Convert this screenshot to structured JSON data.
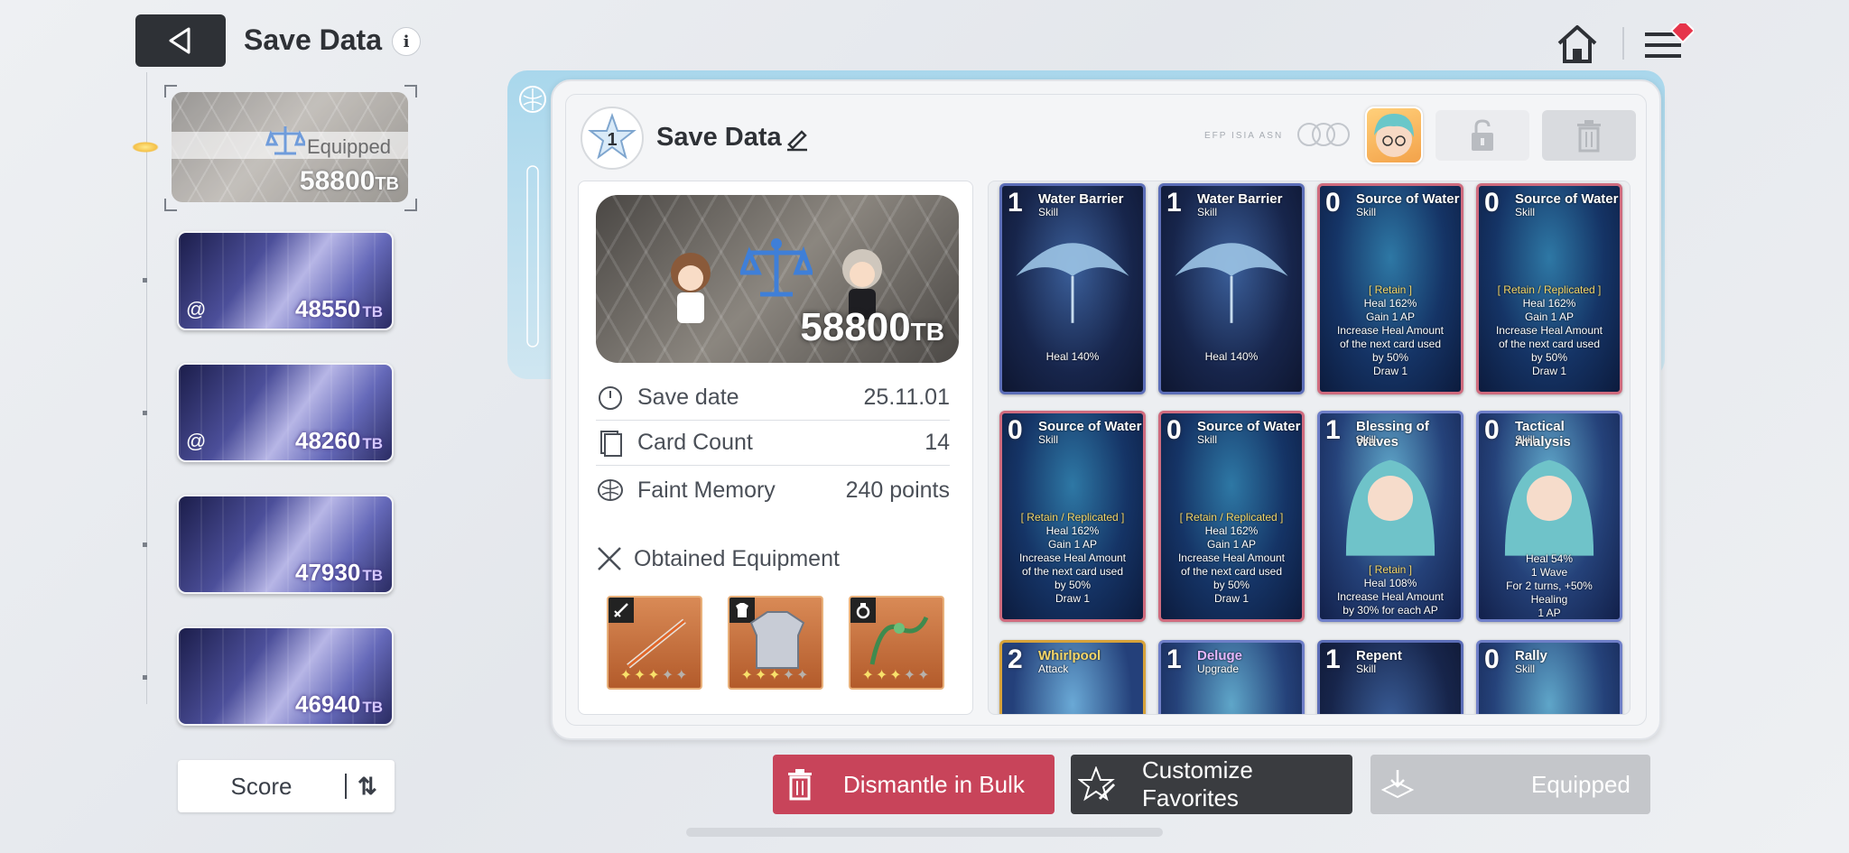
{
  "header": {
    "title": "Save Data",
    "info_glyph": "i",
    "back_icon": "back-arrow-icon",
    "home_icon": "home-icon",
    "menu_icon": "hamburger-menu-icon"
  },
  "slots": [
    {
      "score": "58800",
      "unit": "TB",
      "equipped_label": "Equipped",
      "selected": true
    },
    {
      "score": "48550",
      "unit": "TB"
    },
    {
      "score": "48260",
      "unit": "TB"
    },
    {
      "score": "47930",
      "unit": "TB"
    },
    {
      "score": "46940",
      "unit": "TB"
    }
  ],
  "sort": {
    "label": "Score",
    "icon": "sort-order-icon"
  },
  "detail": {
    "rank": "1",
    "name": "Save Data",
    "faint_text": "EFP ISIA ASN",
    "score": "58800",
    "unit": "TB",
    "stats": [
      {
        "label": "Save date",
        "value": "25.11.01",
        "icon": "clock-icon"
      },
      {
        "label": "Card Count",
        "value": "14",
        "icon": "cards-icon"
      },
      {
        "label": "Faint Memory",
        "value": "240 points",
        "icon": "brain-icon"
      }
    ],
    "equipment_label": "Obtained Equipment",
    "equipment": [
      {
        "type": "weapon",
        "icon": "sword-icon",
        "stars_filled": 3,
        "stars_total": 5
      },
      {
        "type": "armor",
        "icon": "armor-icon",
        "stars_filled": 3,
        "stars_total": 5
      },
      {
        "type": "accessory",
        "icon": "ring-icon",
        "stars_filled": 3,
        "stars_total": 5
      }
    ]
  },
  "cards": [
    {
      "cost": "1",
      "name": "Water Barrier",
      "type": "Skill",
      "lines": [
        "Heal 140%"
      ]
    },
    {
      "cost": "1",
      "name": "Water Barrier",
      "type": "Skill",
      "lines": [
        "Heal 140%"
      ]
    },
    {
      "cost": "0",
      "name": "Source of Water",
      "type": "Skill",
      "lines": [
        "[ Retain ]",
        "Heal 162%",
        "Gain 1 AP",
        "Increase Heal Amount",
        "of the next card used",
        "by 50%",
        "Draw 1"
      ]
    },
    {
      "cost": "0",
      "name": "Source of Water",
      "type": "Skill",
      "lines": [
        "[ Retain / Replicated ]",
        "Heal 162%",
        "Gain 1 AP",
        "Increase Heal Amount",
        "of the next card used",
        "by 50%",
        "Draw 1"
      ]
    },
    {
      "cost": "0",
      "name": "Source of Water",
      "type": "Skill",
      "lines": [
        "[ Retain / Replicated ]",
        "Heal 162%",
        "Gain 1 AP",
        "Increase Heal Amount",
        "of the next card used",
        "by 50%",
        "Draw 1"
      ]
    },
    {
      "cost": "0",
      "name": "Source of Water",
      "type": "Skill",
      "lines": [
        "[ Retain / Replicated ]",
        "Heal 162%",
        "Gain 1 AP",
        "Increase Heal Amount",
        "of the next card used",
        "by 50%",
        "Draw 1"
      ]
    },
    {
      "cost": "1",
      "name": "Blessing of Waves",
      "type": "Skill",
      "lines": [
        "[ Retain ]",
        "Heal 108%",
        "Increase Heal Amount",
        "by 30% for each AP"
      ]
    },
    {
      "cost": "0",
      "name": "Tactical Analysis",
      "type": "Skill",
      "lines": [
        "Heal 54%",
        "1 Wave",
        "For 2 turns, +50%",
        "Healing",
        "1 AP"
      ]
    },
    {
      "cost": "2",
      "name": "Whirlpool",
      "type": "Attack",
      "lines": []
    },
    {
      "cost": "1",
      "name": "Deluge",
      "type": "Upgrade",
      "lines": []
    },
    {
      "cost": "1",
      "name": "Repent",
      "type": "Skill",
      "lines": []
    },
    {
      "cost": "0",
      "name": "Rally",
      "type": "Skill",
      "lines": []
    }
  ],
  "actions": {
    "dismantle": "Dismantle in Bulk",
    "favorites": "Customize Favorites",
    "equipped": "Equipped"
  },
  "colors": {
    "accent_red": "#c8445a",
    "dark_button": "#3a3c40",
    "disabled_button": "#c4c6ca",
    "heal_highlight": "#7fd6ff",
    "retain_highlight": "#f5d76a"
  }
}
